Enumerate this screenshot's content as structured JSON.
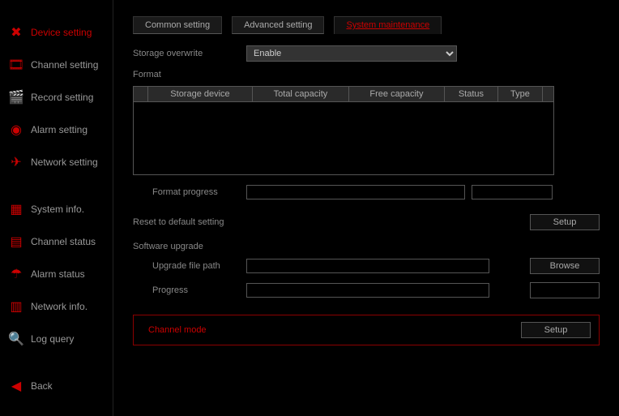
{
  "sidebar": {
    "items": [
      {
        "label": "Device setting"
      },
      {
        "label": "Channel setting"
      },
      {
        "label": "Record setting"
      },
      {
        "label": "Alarm setting"
      },
      {
        "label": "Network setting"
      },
      {
        "label": "System info."
      },
      {
        "label": "Channel status"
      },
      {
        "label": "Alarm status"
      },
      {
        "label": "Network info."
      },
      {
        "label": "Log query"
      },
      {
        "label": "Back"
      }
    ]
  },
  "tabs": {
    "common": "Common setting",
    "advanced": "Advanced setting",
    "system": "System maintenance"
  },
  "storage": {
    "overwrite_label": "Storage overwrite",
    "overwrite_value": "Enable",
    "format_label": "Format",
    "columns": {
      "blank": "",
      "device": "Storage device",
      "total": "Total capacity",
      "free": "Free capacity",
      "status": "Status",
      "type": "Type"
    },
    "format_progress_label": "Format progress"
  },
  "reset": {
    "label": "Reset to default setting",
    "button": "Setup"
  },
  "upgrade": {
    "title": "Software upgrade",
    "path_label": "Upgrade file path",
    "browse": "Browse",
    "progress_label": "Progress"
  },
  "channel_mode": {
    "label": "Channel mode",
    "button": "Setup"
  }
}
